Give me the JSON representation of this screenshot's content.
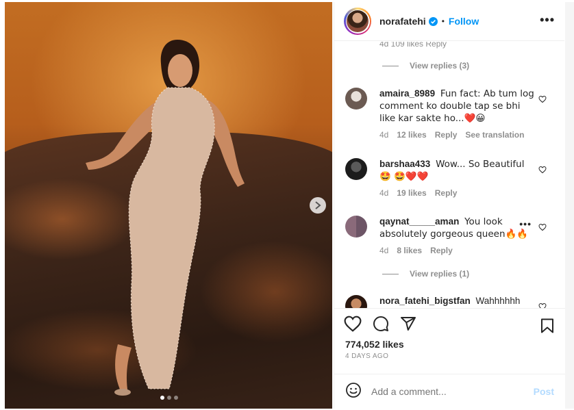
{
  "post": {
    "username": "norafatehi",
    "follow_label": "Follow",
    "separator": "•",
    "more_label": "•••",
    "carousel": {
      "slides": 3,
      "active": 1
    }
  },
  "comments_area": {
    "cut_meta": "4d   109 likes   Reply",
    "view_replies_1": "View replies (3)",
    "view_replies_2": "View replies (1)",
    "comments": [
      {
        "user": "amaira_8989",
        "text": "Fun fact: Ab tum log comment ko double tap se bhi like kar sakte ho...❤️😀",
        "age": "4d",
        "likes": "12 likes",
        "reply": "Reply",
        "translate": "See translation"
      },
      {
        "user": "barshaa433",
        "text": "Wow... So Beautiful 🤩 🤩❤️❤️",
        "age": "4d",
        "likes": "19 likes",
        "reply": "Reply"
      },
      {
        "user": "qaynat_____aman",
        "text": "You look absolutely gorgeous queen🔥🔥",
        "age": "4d",
        "likes": "8 likes",
        "reply": "Reply"
      },
      {
        "user": "nora_fatehi_bigstfan",
        "text": "Wahhhhhh"
      }
    ]
  },
  "actions": {
    "likes": "774,052 likes",
    "date": "4 DAYS AGO"
  },
  "add_comment": {
    "placeholder": "Add a comment...",
    "post_label": "Post"
  }
}
